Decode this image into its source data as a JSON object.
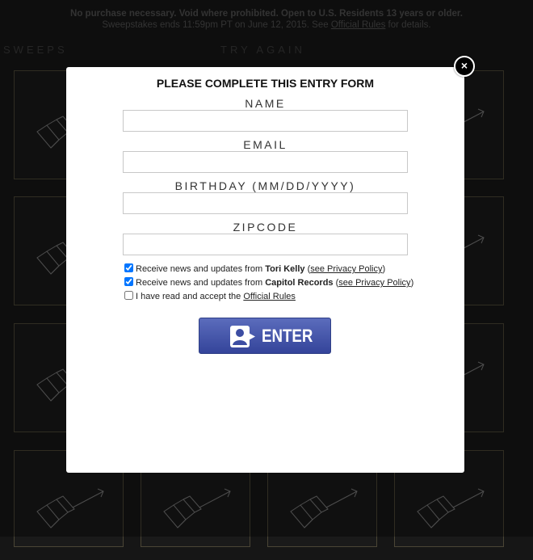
{
  "background": {
    "notice_line1": "No purchase necessary. Void where prohibited. Open to U.S. Residents 13 years or older.",
    "notice_line2_prefix": "Sweepstakes ends 11:59pm PT on June 12, 2015. See ",
    "notice_line2_link": "Official Rules",
    "notice_line2_suffix": " for details.",
    "heading_left": "SWEEPS",
    "heading_right": "TRY AGAIN"
  },
  "modal": {
    "close_label": "×",
    "title": "PLEASE COMPLETE THIS ENTRY FORM",
    "fields": {
      "name": {
        "label": "NAME",
        "value": ""
      },
      "email": {
        "label": "EMAIL",
        "value": ""
      },
      "birthday": {
        "label": "BIRTHDAY (MM/DD/YYYY)",
        "value": ""
      },
      "zipcode": {
        "label": "ZIPCODE",
        "value": ""
      }
    },
    "checkboxes": {
      "tori": {
        "checked": true,
        "prefix": "Receive news and updates from ",
        "bold": "Tori Kelly",
        "open": " (",
        "link": "see Privacy Policy",
        "close": ")"
      },
      "capitol": {
        "checked": true,
        "prefix": "Receive news and updates from ",
        "bold": "Capitol Records",
        "open": " (",
        "link": "see Privacy Policy",
        "close": ")"
      },
      "rules": {
        "checked": false,
        "prefix": "I have read and accept the ",
        "link": "Official Rules"
      }
    },
    "enter_button": {
      "label": "ENTER",
      "icon": "user-card-icon",
      "color": "#3c4da3"
    }
  },
  "colors": {
    "page_background": "#161616",
    "tile_border": "#4a4535",
    "modal_background": "#ffffff"
  }
}
